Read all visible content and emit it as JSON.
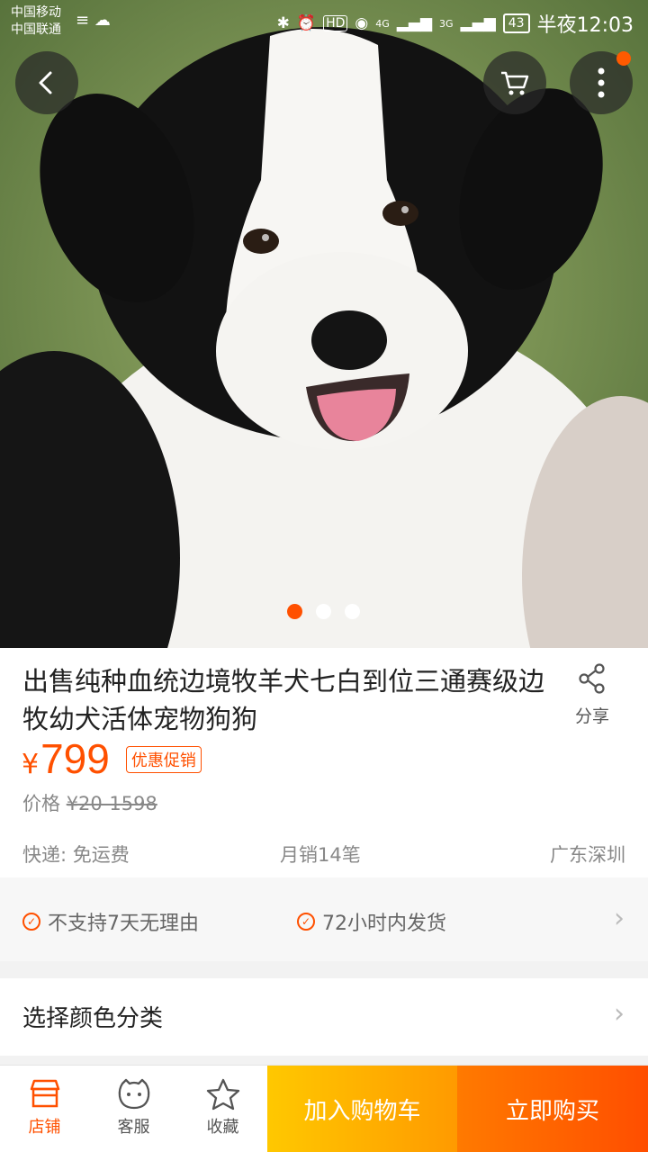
{
  "status_bar": {
    "carrier_1": "中国移动",
    "carrier_2": "中国联通",
    "network_1": "4G",
    "network_2": "3G",
    "hd": "HD",
    "battery": "43",
    "time": "半夜12:03"
  },
  "gallery": {
    "image_subject": "border-collie-puppy",
    "slide_count": 3,
    "active_slide": 1
  },
  "product": {
    "title": "出售纯种血统边境牧羊犬七白到位三通赛级边牧幼犬活体宠物狗狗",
    "currency": "¥",
    "price": "799",
    "promo_tag": "优惠促销",
    "original_price_label": "价格",
    "original_price": "¥20-1598",
    "shipping": "快递: 免运费",
    "monthly_sales": "月销14笔",
    "location": "广东深圳"
  },
  "share": {
    "label": "分享"
  },
  "services": [
    {
      "label": "不支持7天无理由"
    },
    {
      "label": "72小时内发货"
    }
  ],
  "select": {
    "label": "选择颜色分类"
  },
  "bottom_bar": {
    "store": "店铺",
    "service": "客服",
    "favorite": "收藏",
    "add_to_cart": "加入购物车",
    "buy_now": "立即购买"
  },
  "colors": {
    "accent": "#ff5000",
    "cart_gradient": [
      "#ffc800",
      "#ff9a00"
    ],
    "buy_gradient": [
      "#ff7a00",
      "#ff4e00"
    ]
  }
}
